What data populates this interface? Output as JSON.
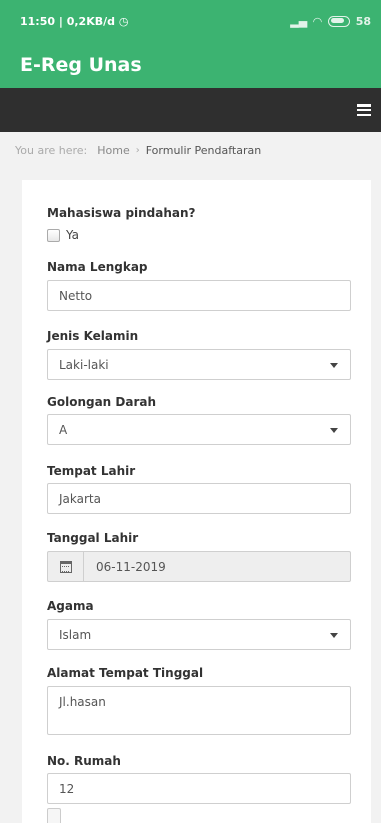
{
  "status": {
    "time": "11:50",
    "speed": "0,2KB/d",
    "battery": "58"
  },
  "app": {
    "title": "E-Reg Unas"
  },
  "breadcrumb": {
    "prefix": "You are here:",
    "home": "Home",
    "sep": "›",
    "current": "Formulir Pendaftaran"
  },
  "form": {
    "transfer_label": "Mahasiswa pindahan?",
    "transfer_option": "Ya",
    "name_label": "Nama Lengkap",
    "name_value": "Netto",
    "gender_label": "Jenis Kelamin",
    "gender_value": "Laki-laki",
    "blood_label": "Golongan Darah",
    "blood_value": "A",
    "birthplace_label": "Tempat Lahir",
    "birthplace_value": "Jakarta",
    "birthdate_label": "Tanggal Lahir",
    "birthdate_value": "06-11-2019",
    "religion_label": "Agama",
    "religion_value": "Islam",
    "address_label": "Alamat Tempat Tinggal",
    "address_value": "Jl.hasan",
    "house_label": "No. Rumah",
    "house_value": "12"
  },
  "icons": {
    "menu": "hamburger-icon",
    "calendar": "calendar-icon",
    "alarm": "alarm-icon",
    "signal": "signal-icon",
    "wifi": "wifi-icon",
    "battery": "battery-icon"
  },
  "colors": {
    "header_green": "#3cb371",
    "navbar": "#2f2f2f"
  }
}
